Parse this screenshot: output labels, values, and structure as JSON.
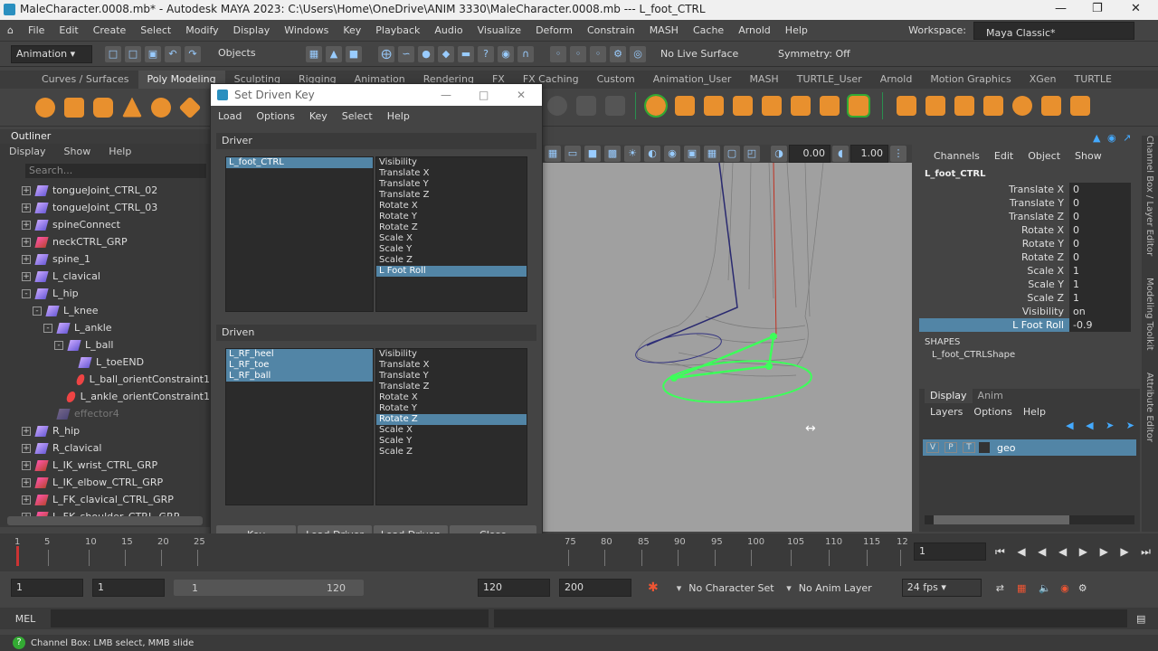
{
  "window": {
    "title": "MaleCharacter.0008.mb* - Autodesk MAYA 2023: C:\\Users\\Home\\OneDrive\\ANIM 3330\\MaleCharacter.0008.mb  ---  L_foot_CTRL"
  },
  "menubar": [
    "File",
    "Edit",
    "Create",
    "Select",
    "Modify",
    "Display",
    "Windows",
    "Key",
    "Playback",
    "Audio",
    "Visualize",
    "Deform",
    "Constrain",
    "MASH",
    "Cache",
    "Arnold",
    "Help"
  ],
  "workspace": {
    "label": "Workspace:",
    "value": "Maya Classic*"
  },
  "status": {
    "menuset": "Animation",
    "objects": "Objects",
    "live_surface": "No Live Surface",
    "symmetry": "Symmetry: Off"
  },
  "shelf_tabs": [
    "Curves / Surfaces",
    "Poly Modeling",
    "Sculpting",
    "Rigging",
    "Animation",
    "Rendering",
    "FX",
    "FX Caching",
    "Custom",
    "Animation_User",
    "MASH",
    "TURTLE_User",
    "Arnold",
    "Motion Graphics",
    "XGen",
    "TURTLE"
  ],
  "outliner": {
    "title": "Outliner",
    "menu": [
      "Display",
      "Show",
      "Help"
    ],
    "search_placeholder": "Search...",
    "items": [
      {
        "label": "tongueJoint_CTRL_02",
        "indent": 0,
        "type": "joint",
        "exp": "+"
      },
      {
        "label": "tongueJoint_CTRL_03",
        "indent": 0,
        "type": "joint",
        "exp": "+"
      },
      {
        "label": "spineConnect",
        "indent": 0,
        "type": "joint",
        "exp": "+"
      },
      {
        "label": "neckCTRL_GRP",
        "indent": 0,
        "type": "grp",
        "exp": "+"
      },
      {
        "label": "spine_1",
        "indent": 0,
        "type": "joint",
        "exp": "+"
      },
      {
        "label": "L_clavical",
        "indent": 0,
        "type": "joint",
        "exp": "+"
      },
      {
        "label": "L_hip",
        "indent": 0,
        "type": "joint",
        "exp": "-"
      },
      {
        "label": "L_knee",
        "indent": 1,
        "type": "joint",
        "exp": "-"
      },
      {
        "label": "L_ankle",
        "indent": 2,
        "type": "joint",
        "exp": "-"
      },
      {
        "label": "L_ball",
        "indent": 3,
        "type": "joint",
        "exp": "-"
      },
      {
        "label": "L_toeEND",
        "indent": 4,
        "type": "joint",
        "exp": ""
      },
      {
        "label": "L_ball_orientConstraint1",
        "indent": 4,
        "type": "con",
        "exp": ""
      },
      {
        "label": "L_ankle_orientConstraint1",
        "indent": 3,
        "type": "con",
        "exp": ""
      },
      {
        "label": "effector4",
        "indent": 2,
        "type": "dim",
        "exp": ""
      },
      {
        "label": "R_hip",
        "indent": 0,
        "type": "joint",
        "exp": "+"
      },
      {
        "label": "R_clavical",
        "indent": 0,
        "type": "joint",
        "exp": "+"
      },
      {
        "label": "L_IK_wrist_CTRL_GRP",
        "indent": 0,
        "type": "grp",
        "exp": "+"
      },
      {
        "label": "L_IK_elbow_CTRL_GRP",
        "indent": 0,
        "type": "grp",
        "exp": "+"
      },
      {
        "label": "L_FK_clavical_CTRL_GRP",
        "indent": 0,
        "type": "grp",
        "exp": "+"
      },
      {
        "label": "L_FK_shoulder_CTRL_GRP",
        "indent": 0,
        "type": "grp",
        "exp": "+"
      }
    ]
  },
  "viewport": {
    "val1": "0.00",
    "val2": "1.00"
  },
  "sdk": {
    "title": "Set Driven Key",
    "menu": [
      "Load",
      "Options",
      "Key",
      "Select",
      "Help"
    ],
    "driver_label": "Driver",
    "driven_label": "Driven",
    "driver_objects": [
      {
        "label": "L_foot_CTRL",
        "sel": true
      }
    ],
    "driver_attrs": [
      {
        "label": "Visibility",
        "sel": false
      },
      {
        "label": "Translate X",
        "sel": false
      },
      {
        "label": "Translate Y",
        "sel": false
      },
      {
        "label": "Translate Z",
        "sel": false
      },
      {
        "label": "Rotate X",
        "sel": false
      },
      {
        "label": "Rotate Y",
        "sel": false
      },
      {
        "label": "Rotate Z",
        "sel": false
      },
      {
        "label": "Scale X",
        "sel": false
      },
      {
        "label": "Scale Y",
        "sel": false
      },
      {
        "label": "Scale Z",
        "sel": false
      },
      {
        "label": "L Foot Roll",
        "sel": true
      }
    ],
    "driven_objects": [
      {
        "label": "L_RF_heel",
        "sel": true
      },
      {
        "label": "L_RF_toe",
        "sel": true
      },
      {
        "label": "L_RF_ball",
        "sel": true
      }
    ],
    "driven_attrs": [
      {
        "label": "Visibility",
        "sel": false
      },
      {
        "label": "Translate X",
        "sel": false
      },
      {
        "label": "Translate Y",
        "sel": false
      },
      {
        "label": "Translate Z",
        "sel": false
      },
      {
        "label": "Rotate X",
        "sel": false
      },
      {
        "label": "Rotate Y",
        "sel": false
      },
      {
        "label": "Rotate Z",
        "sel": true
      },
      {
        "label": "Scale X",
        "sel": false
      },
      {
        "label": "Scale Y",
        "sel": false
      },
      {
        "label": "Scale Z",
        "sel": false
      }
    ],
    "buttons": {
      "key": "Key",
      "load_driver": "Load Driver",
      "load_driven": "Load Driven",
      "close": "Close"
    }
  },
  "channelbox": {
    "menu": [
      "Channels",
      "Edit",
      "Object",
      "Show"
    ],
    "object": "L_foot_CTRL",
    "channels": [
      {
        "name": "Translate X",
        "value": "0",
        "sel": false
      },
      {
        "name": "Translate Y",
        "value": "0",
        "sel": false
      },
      {
        "name": "Translate Z",
        "value": "0",
        "sel": false
      },
      {
        "name": "Rotate X",
        "value": "0",
        "sel": false
      },
      {
        "name": "Rotate Y",
        "value": "0",
        "sel": false
      },
      {
        "name": "Rotate Z",
        "value": "0",
        "sel": false
      },
      {
        "name": "Scale X",
        "value": "1",
        "sel": false
      },
      {
        "name": "Scale Y",
        "value": "1",
        "sel": false
      },
      {
        "name": "Scale Z",
        "value": "1",
        "sel": false
      },
      {
        "name": "Visibility",
        "value": "on",
        "sel": false
      },
      {
        "name": "L Foot Roll",
        "value": "-0.9",
        "sel": true
      }
    ],
    "shapes_label": "SHAPES",
    "shape": "L_foot_CTRLShape",
    "side_tabs": [
      "Channel Box / Layer Editor",
      "Modeling Toolkit",
      "Attribute Editor"
    ]
  },
  "layers": {
    "tabs": [
      "Display",
      "Anim"
    ],
    "menu": [
      "Layers",
      "Options",
      "Help"
    ],
    "layer": {
      "v": "V",
      "p": "P",
      "t": "T",
      "name": "geo"
    }
  },
  "timeline": {
    "ticks": [
      "1",
      "5",
      "10",
      "15",
      "20",
      "25",
      "75",
      "80",
      "85",
      "90",
      "95",
      "100",
      "105",
      "110",
      "115",
      "12"
    ],
    "current": "1"
  },
  "range": {
    "start": "1",
    "playstart": "1",
    "slider_start": "1",
    "slider_end": "120",
    "playend": "120",
    "end": "200",
    "charset": "No Character Set",
    "animlayer": "No Anim Layer",
    "fps": "24 fps"
  },
  "cmd": {
    "lang": "MEL"
  },
  "help": {
    "text": "Channel Box: LMB select, MMB slide"
  }
}
